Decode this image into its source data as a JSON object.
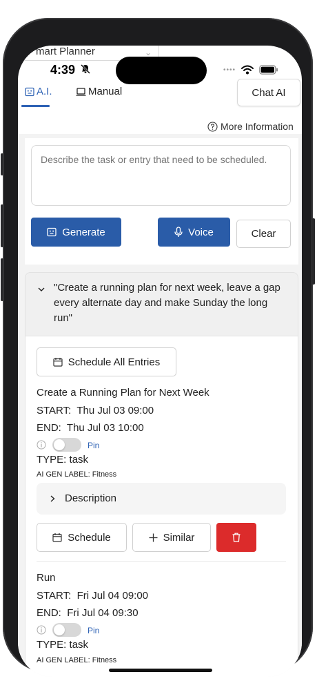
{
  "previous_dropdown": {
    "value": "mart Planner"
  },
  "status_bar": {
    "time": "4:39",
    "dots": "••••"
  },
  "tabs": [
    {
      "label": "A.I.",
      "active": true
    },
    {
      "label": "Manual",
      "active": false
    }
  ],
  "chat_button": {
    "label": "Chat AI"
  },
  "more_info": {
    "label": "More Information"
  },
  "input": {
    "placeholder": "Describe the task or entry that need to be scheduled.",
    "value": ""
  },
  "actions": {
    "generate": "Generate",
    "voice": "Voice",
    "clear": "Clear"
  },
  "result": {
    "prompt": "\"Create a running plan for next week, leave a gap every alternate day and make Sunday the long run\"",
    "schedule_all": "Schedule All Entries",
    "entries": [
      {
        "title": "Create a Running Plan for Next Week",
        "start_label": "START:",
        "start": "Thu Jul 03 09:00",
        "end_label": "END:",
        "end": "Thu Jul 03 10:00",
        "pin": "Pin",
        "type_label": "TYPE:",
        "type": "task",
        "ai_label": "AI GEN LABEL:",
        "ai_value": "Fitness",
        "description": "Description",
        "schedule": "Schedule",
        "similar": "Similar"
      },
      {
        "title": "Run",
        "start_label": "START:",
        "start": "Fri Jul 04 09:00",
        "end_label": "END:",
        "end": "Fri Jul 04 09:30",
        "pin": "Pin",
        "type_label": "TYPE:",
        "type": "task",
        "ai_label": "AI GEN LABEL:",
        "ai_value": "Fitness"
      }
    ]
  },
  "colors": {
    "accent": "#2a5ca8",
    "tab_active": "#2f63b5",
    "delete": "#dc2b2b",
    "background": "#f3f3f3"
  }
}
